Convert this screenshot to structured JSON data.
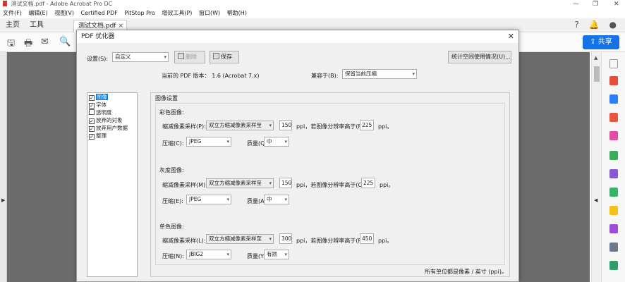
{
  "app": {
    "title": "测试文档.pdf - Adobe Acrobat Pro DC",
    "window_controls": [
      "—",
      "❐",
      "✕"
    ]
  },
  "menu": [
    "文件(F)",
    "编辑(E)",
    "视图(V)",
    "Certified PDF",
    "PitStop Pro",
    "增效工具(P)",
    "窗口(W)",
    "帮助(H)"
  ],
  "tabs": {
    "home": "主页",
    "tools": "工具",
    "doc": "测试文档.pdf",
    "doc_close": "×"
  },
  "topbar_icons": {
    "help": "?",
    "bell": "🔔",
    "user": "●"
  },
  "share_button": "共享",
  "toolbar_icons": [
    "save-icon",
    "print-icon",
    "mail-icon",
    "zoom-icon"
  ],
  "dialog": {
    "title": "PDF 优化器",
    "close": "✕",
    "settings_label": "设置(S):",
    "settings_value": "自定义",
    "delete_label": "删除",
    "save_label": "保存",
    "stats_button": "统计空间使用情况(U)...",
    "version_text": "当前的 PDF 版本： 1.6 (Acrobat 7.x)",
    "compat_label": "兼容于(B):",
    "compat_value": "保留当前压缩",
    "categories": [
      {
        "label": "图像",
        "checked": true,
        "selected": true
      },
      {
        "label": "字体",
        "checked": true
      },
      {
        "label": "透明度",
        "checked": false
      },
      {
        "label": "放弃的对象",
        "checked": true
      },
      {
        "label": "放弃用户数据",
        "checked": true
      },
      {
        "label": "整理",
        "checked": true
      }
    ],
    "image_settings": {
      "heading": "图像设置",
      "color": {
        "title": "彩色图像:",
        "downsample_label": "缩减像素采样(P):",
        "downsample_value": "双立方缩减像素采样至",
        "ppi": "150",
        "ppi_unit": "ppi，若图像分辨率高于(F)",
        "above": "225",
        "above_unit": "ppi。",
        "compression_label": "压缩(C):",
        "compression_value": "JPEG",
        "quality_label": "质量(Q):",
        "quality_value": "中"
      },
      "gray": {
        "title": "灰度图像:",
        "downsample_label": "缩减像素采样(M):",
        "downsample_value": "双立方缩减像素采样至",
        "ppi": "150",
        "ppi_unit": "ppi，若图像分辨率高于(O)",
        "above": "225",
        "above_unit": "ppi。",
        "compression_label": "压缩(E):",
        "compression_value": "JPEG",
        "quality_label": "质量(A):",
        "quality_value": "中"
      },
      "mono": {
        "title": "单色图像:",
        "downsample_label": "缩减像素采样(L):",
        "downsample_value": "双立方缩减像素采样至",
        "ppi": "300",
        "ppi_unit": "ppi，若图像分辨率高于(R)",
        "above": "450",
        "above_unit": "ppi。",
        "compression_label": "压缩(N):",
        "compression_value": "JBIG2",
        "quality_label": "质量(Y):",
        "quality_value": "有损"
      },
      "footer": "所有单位都是像素 / 英寸 (ppi)。"
    }
  }
}
